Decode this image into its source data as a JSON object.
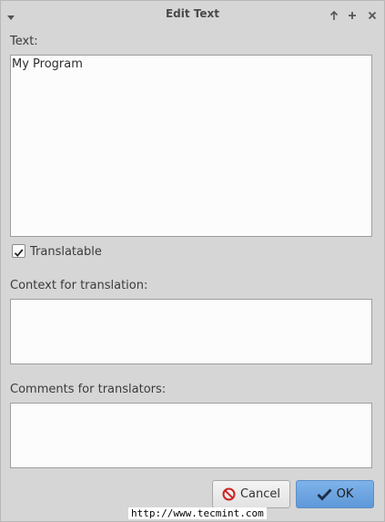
{
  "window": {
    "title": "Edit Text",
    "controls": [
      "arrow-up-icon",
      "plus-icon",
      "close-icon"
    ]
  },
  "text_field": {
    "label": "Text:",
    "value": "My Program"
  },
  "translatable": {
    "label": "Translatable",
    "checked": true
  },
  "context_field": {
    "label": "Context for translation:",
    "value": ""
  },
  "comments_field": {
    "label": "Comments for translators:",
    "value": ""
  },
  "buttons": {
    "cancel_label": "Cancel",
    "ok_label": "OK"
  },
  "watermark": "http://www.tecmint.com",
  "colors": {
    "window_bg": "#d6d6d6",
    "ok_button": "#6aa4e0",
    "cancel_icon": "#cc2222"
  }
}
